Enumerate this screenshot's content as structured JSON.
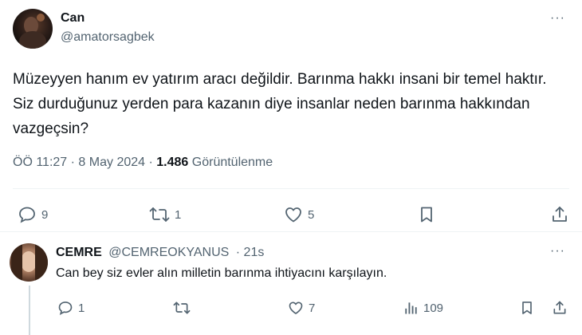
{
  "tweet": {
    "author_name": "Can",
    "author_handle": "@amatorsagbek",
    "more_label": "···",
    "text": "Müzeyyen hanım ev yatırım aracı değildir. Barınma hakkı insani bir temel haktır. Siz durduğunuz yerden para kazanın diye insanlar neden barınma hakkından vazgeçsin?",
    "time": "ÖÖ 11:27",
    "sep": "·",
    "date": "8 May 2024",
    "views_count": "1.486",
    "views_label": "Görüntülenme",
    "actions": {
      "reply_count": "9",
      "retweet_count": "1",
      "like_count": "5",
      "bookmark_icon": "bookmark-icon",
      "share_icon": "share-icon"
    }
  },
  "reply": {
    "author_name": "CEMRE",
    "author_handle": "@CEMREOKYANUS",
    "time": "· 21s",
    "more_label": "···",
    "text": "Can bey siz evler alın milletin barınma ihtiyacını karşılayın.",
    "actions": {
      "reply_count": "1",
      "retweet_count": "",
      "like_count": "7",
      "views_count": "109"
    }
  },
  "colors": {
    "text": "#0f1419",
    "secondary": "#536471",
    "divider": "#eff3f4"
  }
}
